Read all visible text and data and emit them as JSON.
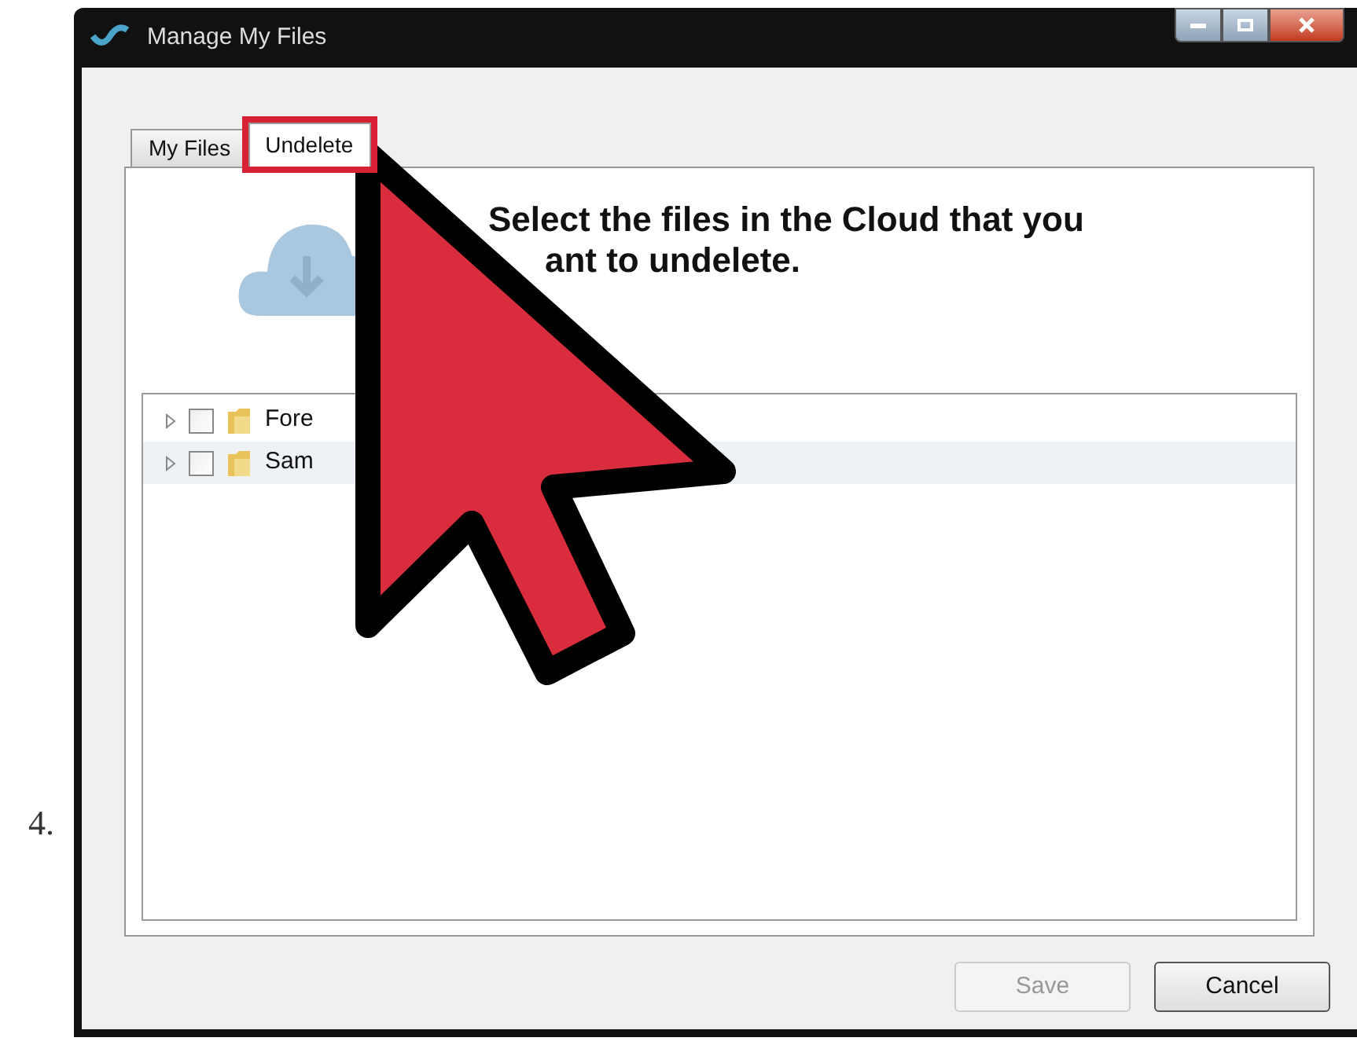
{
  "step_number": "4.",
  "window": {
    "title": "Manage My Files"
  },
  "tabs": [
    {
      "label": "My Files",
      "selected": false,
      "highlighted": false
    },
    {
      "label": "Undelete",
      "selected": true,
      "highlighted": true
    }
  ],
  "heading": {
    "lines": [
      "Select the files in the Cloud that you",
      "ant to undelete."
    ]
  },
  "tree": [
    {
      "label": "Fore",
      "checked": false,
      "selected": false
    },
    {
      "label": "Sam",
      "checked": false,
      "selected": true
    }
  ],
  "buttons": [
    {
      "label": "Save",
      "disabled": true
    },
    {
      "label": "Cancel",
      "disabled": false
    }
  ]
}
